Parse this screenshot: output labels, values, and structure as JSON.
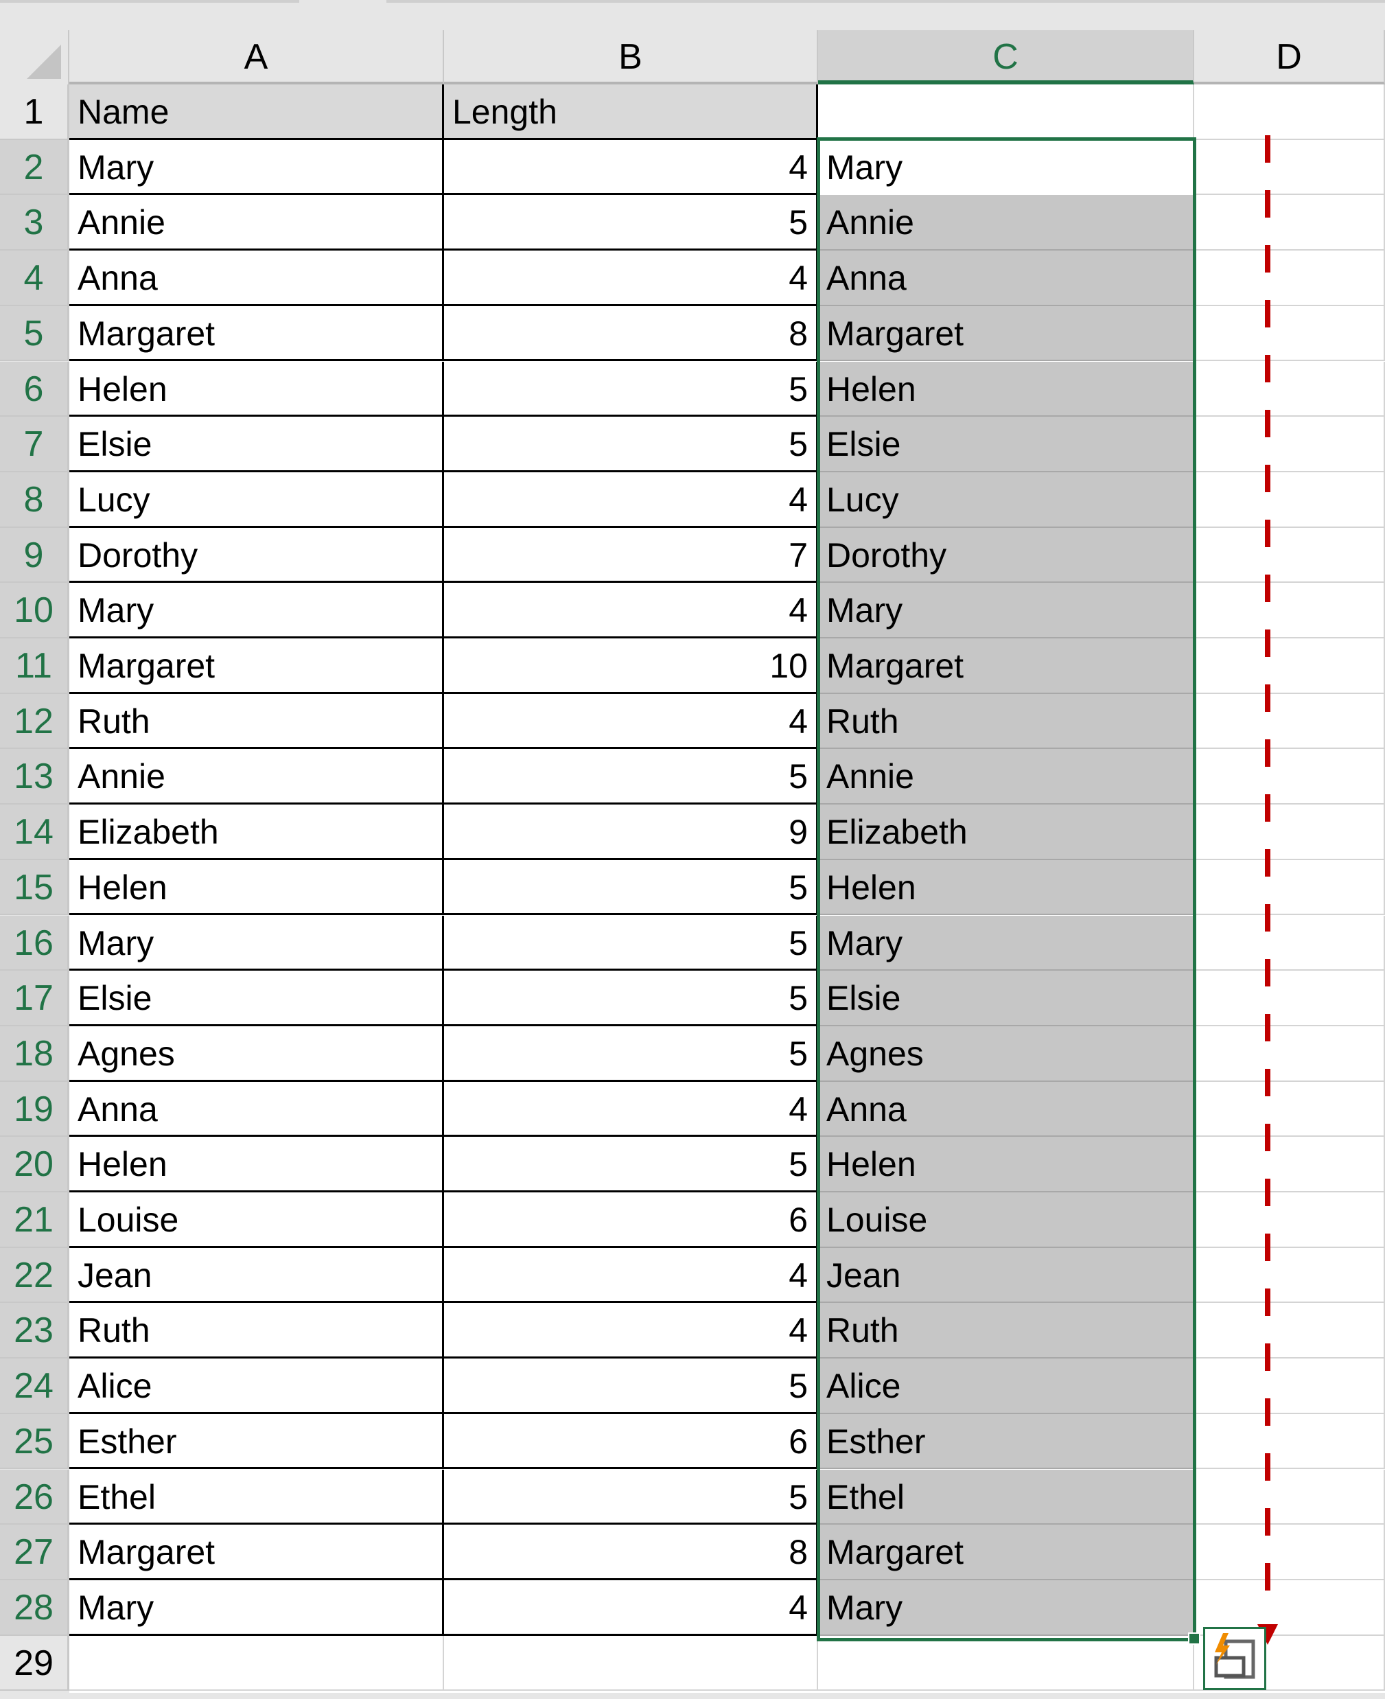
{
  "columns": [
    {
      "label": "A",
      "selected": false
    },
    {
      "label": "B",
      "selected": false
    },
    {
      "label": "C",
      "selected": true
    },
    {
      "label": "D",
      "selected": false
    }
  ],
  "headers": {
    "name": "Name",
    "length": "Length",
    "c": ""
  },
  "rows": [
    {
      "row": "2",
      "name": "Mary",
      "length": "4",
      "c": "Mary"
    },
    {
      "row": "3",
      "name": "Annie",
      "length": "5",
      "c": "Annie"
    },
    {
      "row": "4",
      "name": "Anna",
      "length": "4",
      "c": "Anna"
    },
    {
      "row": "5",
      "name": "Margaret",
      "length": "8",
      "c": "Margaret"
    },
    {
      "row": "6",
      "name": "Helen",
      "length": "5",
      "c": "Helen"
    },
    {
      "row": "7",
      "name": "Elsie",
      "length": "5",
      "c": "Elsie"
    },
    {
      "row": "8",
      "name": "Lucy",
      "length": "4",
      "c": "Lucy"
    },
    {
      "row": "9",
      "name": "Dorothy",
      "length": "7",
      "c": "Dorothy"
    },
    {
      "row": "10",
      "name": "Mary",
      "length": "4",
      "c": "Mary"
    },
    {
      "row": "11",
      "name": "Margaret",
      "length": "10",
      "c": "Margaret"
    },
    {
      "row": "12",
      "name": "Ruth",
      "length": "4",
      "c": "Ruth"
    },
    {
      "row": "13",
      "name": "Annie",
      "length": "5",
      "c": "Annie"
    },
    {
      "row": "14",
      "name": "Elizabeth",
      "length": "9",
      "c": "Elizabeth"
    },
    {
      "row": "15",
      "name": "Helen",
      "length": "5",
      "c": "Helen"
    },
    {
      "row": "16",
      "name": "Mary",
      "length": "5",
      "c": "Mary"
    },
    {
      "row": "17",
      "name": "Elsie",
      "length": "5",
      "c": "Elsie"
    },
    {
      "row": "18",
      "name": "Agnes",
      "length": "5",
      "c": "Agnes"
    },
    {
      "row": "19",
      "name": "Anna",
      "length": "4",
      "c": "Anna"
    },
    {
      "row": "20",
      "name": "Helen",
      "length": "5",
      "c": "Helen"
    },
    {
      "row": "21",
      "name": "Louise",
      "length": "6",
      "c": "Louise"
    },
    {
      "row": "22",
      "name": "Jean",
      "length": "4",
      "c": "Jean"
    },
    {
      "row": "23",
      "name": "Ruth",
      "length": "4",
      "c": "Ruth"
    },
    {
      "row": "24",
      "name": "Alice",
      "length": "5",
      "c": "Alice"
    },
    {
      "row": "25",
      "name": "Esther",
      "length": "6",
      "c": "Esther"
    },
    {
      "row": "26",
      "name": "Ethel",
      "length": "5",
      "c": "Ethel"
    },
    {
      "row": "27",
      "name": "Margaret",
      "length": "8",
      "c": "Margaret"
    },
    {
      "row": "28",
      "name": "Mary",
      "length": "4",
      "c": "Mary"
    }
  ],
  "row_labels": {
    "header": "1",
    "empty": "29"
  },
  "selection": {
    "range": "C2:C28"
  },
  "flash_fill_button": {
    "icon": "flash-fill-options-icon"
  },
  "colors": {
    "accent": "#217346",
    "arrow": "#c00000",
    "header_fill": "#d9d9d9",
    "selection_fill": "#c6c6c6"
  }
}
